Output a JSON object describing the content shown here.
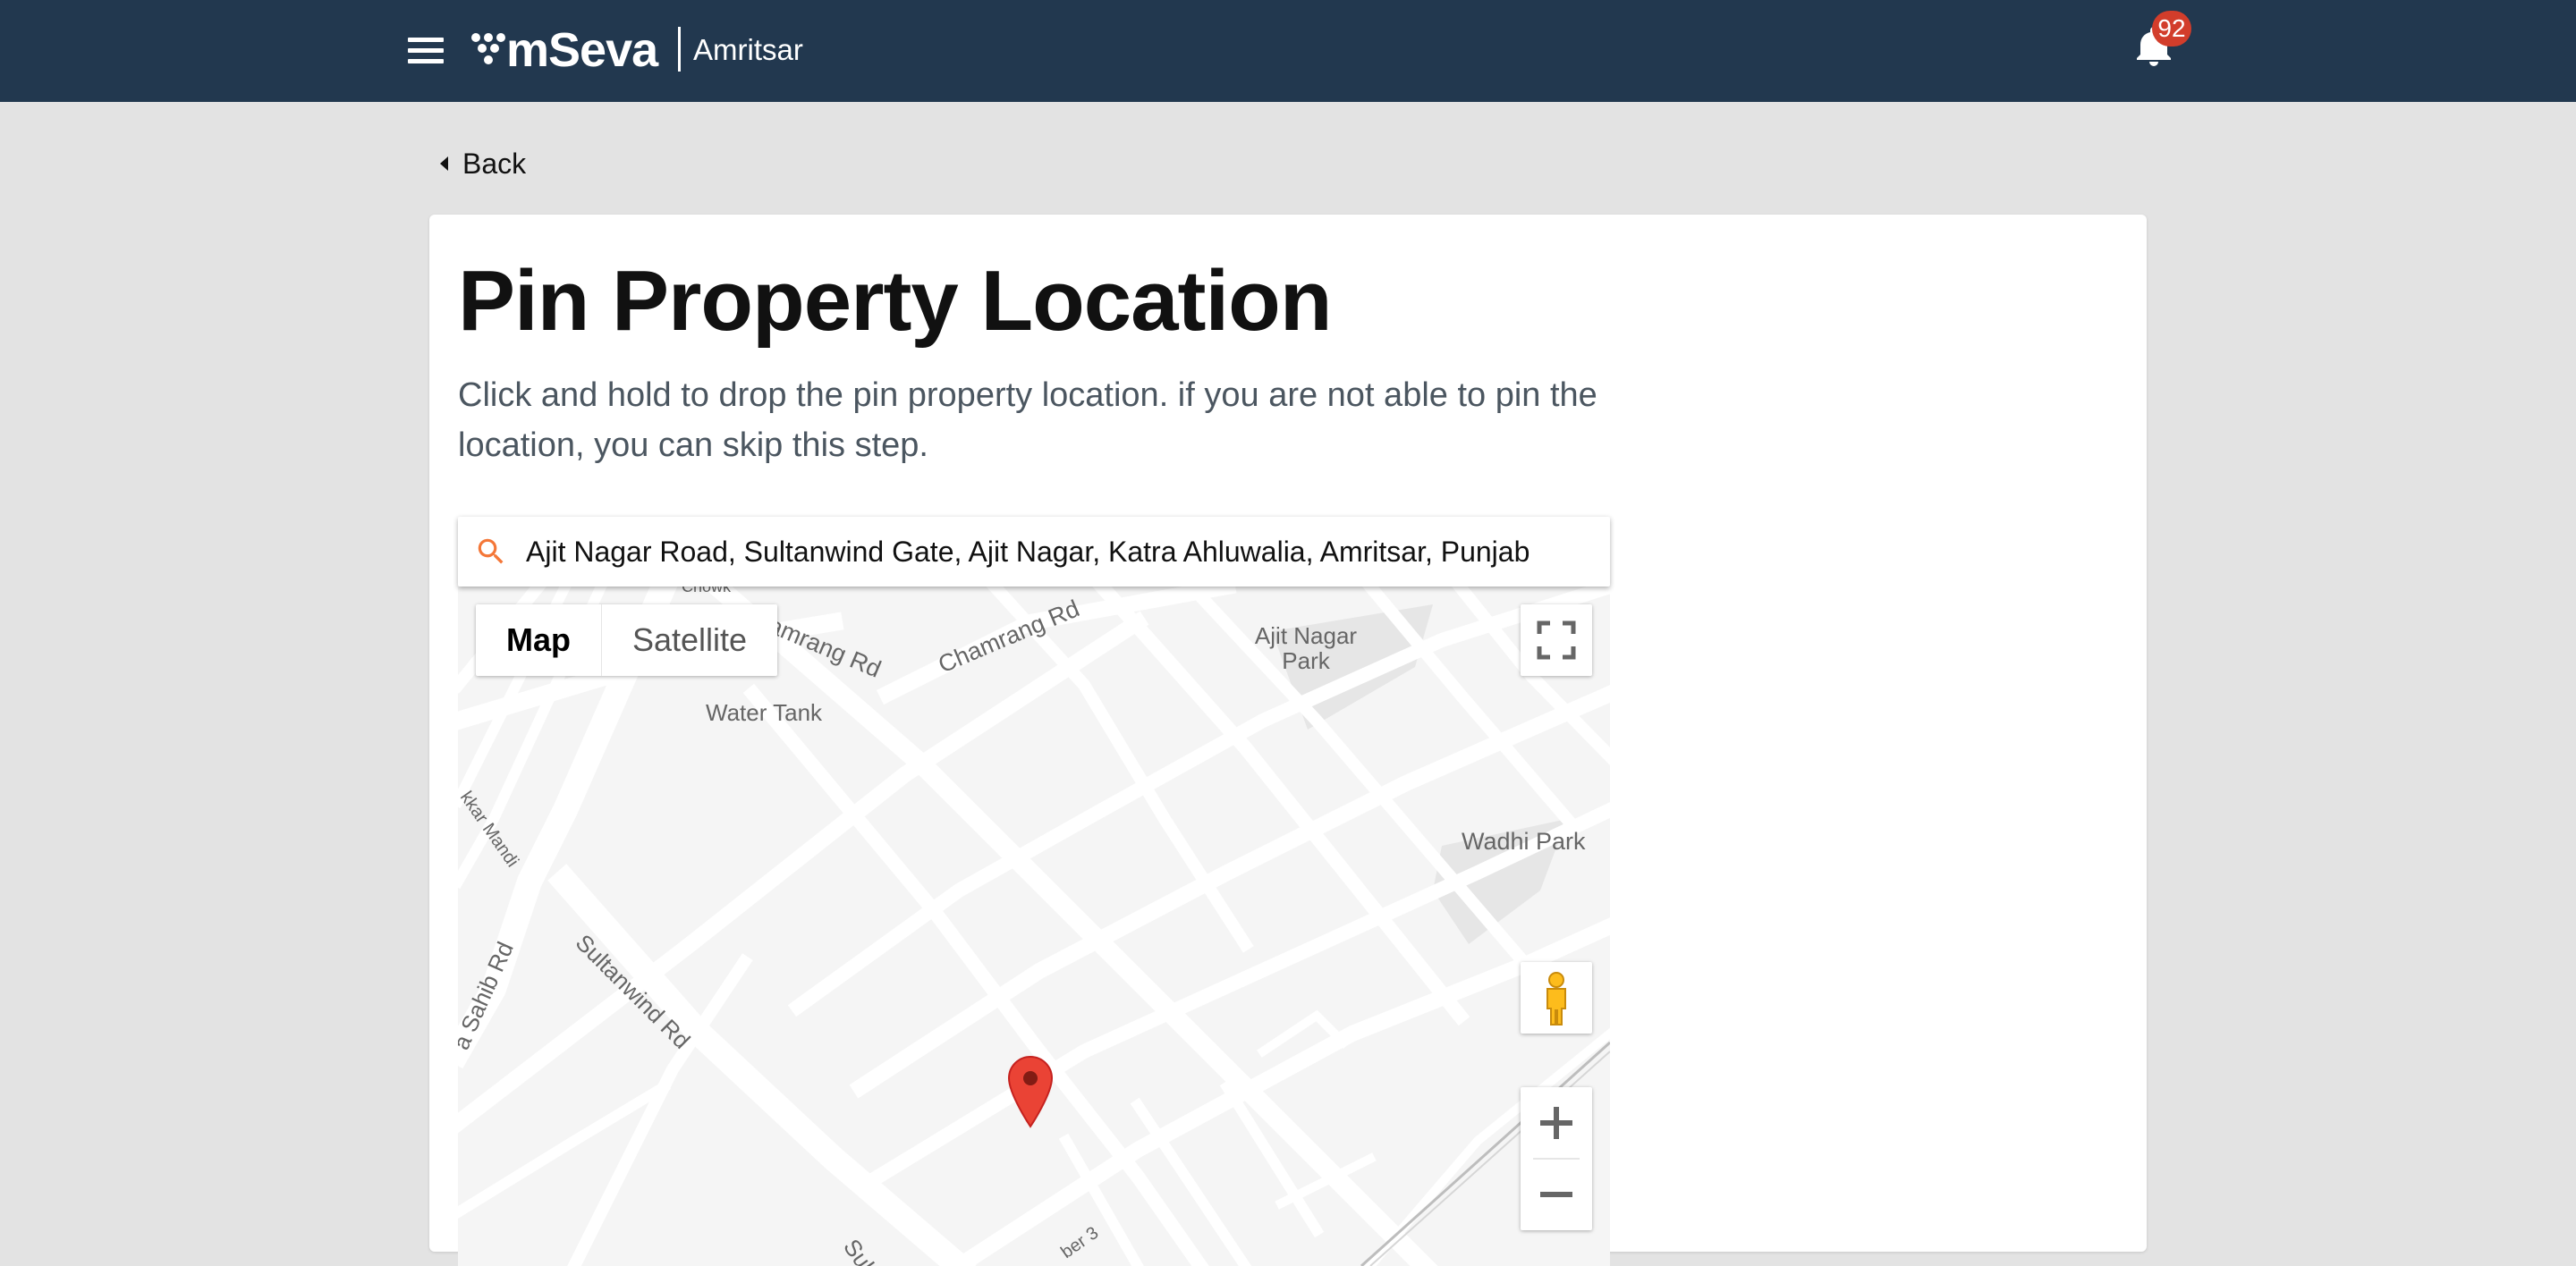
{
  "header": {
    "brand": "mSeva",
    "city": "Amritsar",
    "notification_count": "92"
  },
  "nav": {
    "back_label": "Back"
  },
  "page": {
    "title": "Pin Property Location",
    "description": "Click and hold to drop the pin property location. if you are not able to pin the location, you can skip this step."
  },
  "search": {
    "value": "Ajit Nagar Road, Sultanwind Gate, Ajit Nagar, Katra Ahluwalia, Amritsar, Punjab",
    "icon": "search-icon"
  },
  "map": {
    "type_options": [
      "Map",
      "Satellite"
    ],
    "selected_type": "Map",
    "labels": {
      "chowk": "Chowk",
      "chamrang_rd_1": "Chamrang Rd",
      "chamrang_rd_2": "amrang Rd",
      "ajit_nagar_park_1": "Ajit Nagar",
      "ajit_nagar_park_2": "Park",
      "water_tank": "Water Tank",
      "wadhi_park": "Wadhi Park",
      "kar_mandi": "kkar Mandi",
      "sahib_rd": "a Sahib Rd",
      "sultanwind_rd": "Sultanwind Rd",
      "sult": "Sult",
      "nagar_3": "ber 3"
    },
    "colors": {
      "road": "#ffffff",
      "land": "#f5f5f5",
      "park": "#e6e6e6",
      "pin": "#ea4335"
    }
  }
}
